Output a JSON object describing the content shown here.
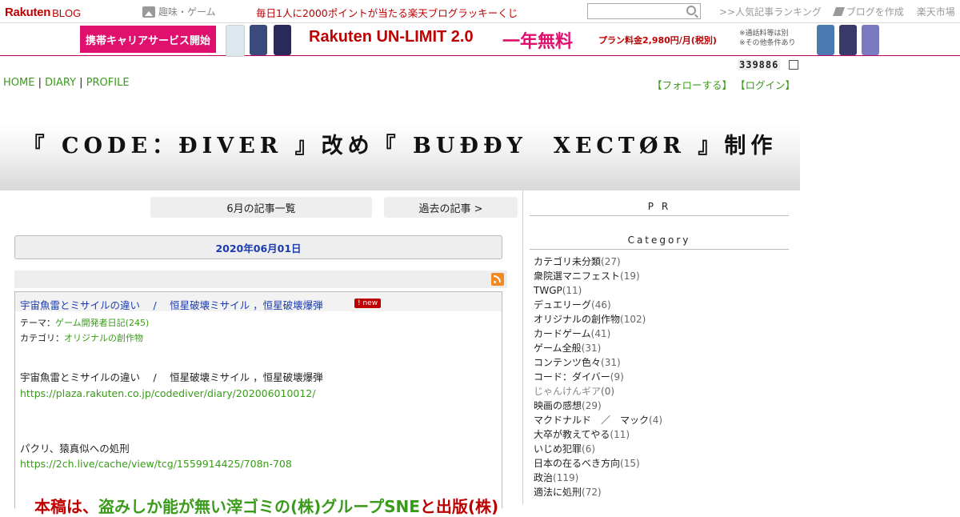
{
  "topbar": {
    "logo_brand": "Rakuten",
    "logo_blog": "BLOG",
    "genre": "趣味・ゲーム",
    "lucky": "毎日1人に2000ポイントが当たる楽天ブログラッキーくじ",
    "ranking": ">>人気記事ランキング",
    "create_blog": "ブログを作成",
    "market": "楽天市場"
  },
  "banner": {
    "career": "携帯キャリアサービス開始",
    "unlimit": "Rakuten UN-LIMIT 2.0",
    "free": "一年無料",
    "price": "プラン料金2,980円/月(税別)",
    "note1": "※通話料等は別",
    "note2": "※その他条件あり"
  },
  "counter": "339886",
  "nav": {
    "home": "HOME",
    "diary": "DIARY",
    "profile": "PROFILE",
    "sep": "|"
  },
  "follow": {
    "follow": "【フォローする】",
    "login": "【ログイン】"
  },
  "blog_title": "『 CODE：ĐIVER 』改め『 BUĐĐY　XECTØR 』制作",
  "main": {
    "month_list": "6月の記事一覧",
    "past": "過去の記事 >",
    "date": "2020年06月01日",
    "article": {
      "title": "宇宙魚雷とミサイルの違い　 /　 恒星破壊ミサイル ，恒星破壊爆弾",
      "new_badge": "! new",
      "theme_label": "テーマ：",
      "theme": "ゲーム開発者日記(245)",
      "category_label": "カテゴリ：",
      "category": "オリジナルの創作物",
      "line1": "宇宙魚雷とミサイルの違い　 /　 恒星破壊ミサイル ，恒星破壊爆弾",
      "link1": "https://plaza.rakuten.co.jp/codediver/diary/202006010012/",
      "line2": "パクリ、猿真似への処刑",
      "link2": "https://2ch.live/cache/view/tcg/1559914425/708n-708",
      "big_red1": "本稿は、",
      "big_green": "盗みしか能が無い滓ゴミの(株)グループSNE",
      "big_red2": "と出版(株)"
    }
  },
  "sidebar": {
    "pr": "P R",
    "category_title": "Category",
    "categories": [
      {
        "name": "カテゴリ未分類",
        "count": "(27)"
      },
      {
        "name": "衆院選マニフェスト",
        "count": "(19)"
      },
      {
        "name": "TWGP",
        "count": "(11)"
      },
      {
        "name": "デュエリーグ",
        "count": "(46)"
      },
      {
        "name": "オリジナルの創作物",
        "count": "(102)"
      },
      {
        "name": "カードゲーム",
        "count": "(41)"
      },
      {
        "name": "ゲーム全般",
        "count": "(31)"
      },
      {
        "name": "コンテンツ色々",
        "count": "(31)"
      },
      {
        "name": "コード：ダイバー",
        "count": "(9)"
      },
      {
        "name": "じゃんけんギア",
        "count": "(0)"
      },
      {
        "name": "映画の感想",
        "count": "(29)"
      },
      {
        "name": "マクドナルド　／　マック",
        "count": "(4)"
      },
      {
        "name": "大卒が教えてやる",
        "count": "(11)"
      },
      {
        "name": "いじめ犯罪",
        "count": "(6)"
      },
      {
        "name": "日本の在るべき方向",
        "count": "(15)"
      },
      {
        "name": "政治",
        "count": "(119)"
      },
      {
        "name": "適法に処刑",
        "count": "(72)"
      }
    ]
  },
  "colors": {
    "rakuten_red": "#bf0000",
    "link_green": "#3a9b1a",
    "link_blue": "#1a3bb0",
    "banner_pink": "#e0106f"
  }
}
